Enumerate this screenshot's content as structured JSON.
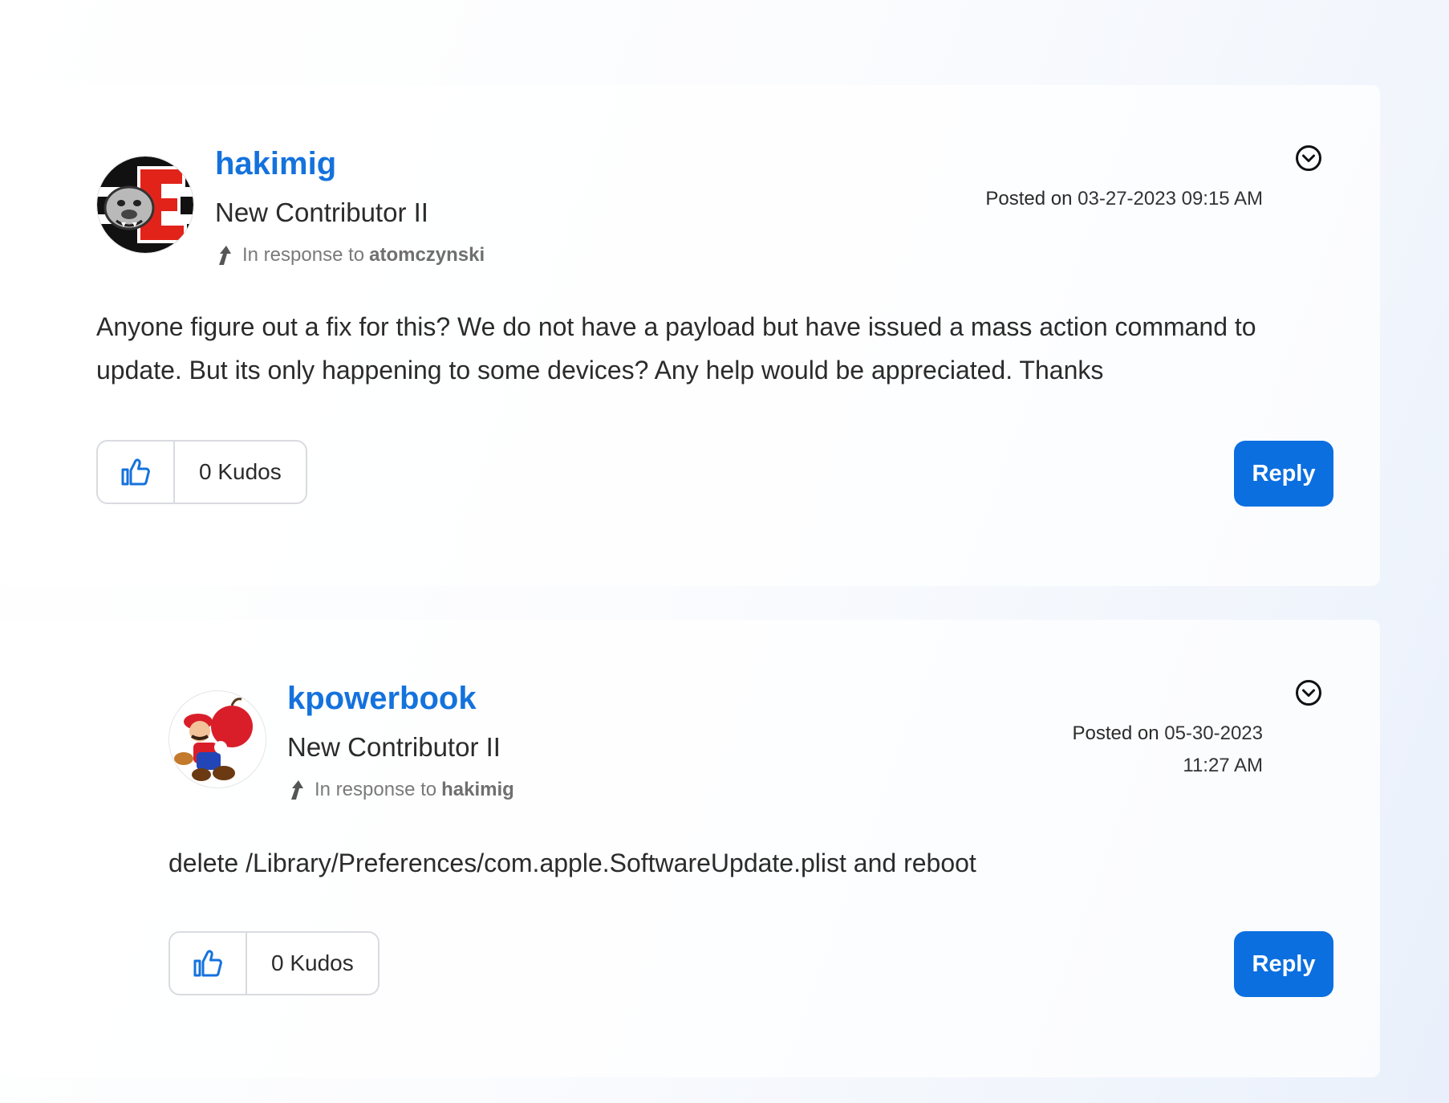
{
  "posts": [
    {
      "username": "hakimig",
      "rank": "New Contributor II",
      "in_response_prefix": "In response to",
      "in_response_to": "atomczynski",
      "posted_label": "Posted on",
      "posted_date": "03-27-2023",
      "posted_time": "09:15 AM",
      "body": "Anyone figure out a fix for this? We do not have a payload but have issued a mass action command to update. But its only happening to some devices? Any help would be appreciated. Thanks",
      "kudos": "0 Kudos",
      "reply": "Reply",
      "avatar": "bulldog-letter-e-logo"
    },
    {
      "username": "kpowerbook",
      "rank": "New Contributor II",
      "in_response_prefix": "In response to",
      "in_response_to": "hakimig",
      "posted_label": "Posted on",
      "posted_date": "05-30-2023",
      "posted_time": "11:27 AM",
      "body": "delete /Library/Preferences/com.apple.SoftwareUpdate.plist and reboot",
      "kudos": "0 Kudos",
      "reply": "Reply",
      "avatar": "mario-apple-character"
    }
  ],
  "colors": {
    "username": "#1472dd",
    "reply_button": "#0b6fe0",
    "text": "#2b2b2b",
    "muted": "#7a7a7a"
  }
}
